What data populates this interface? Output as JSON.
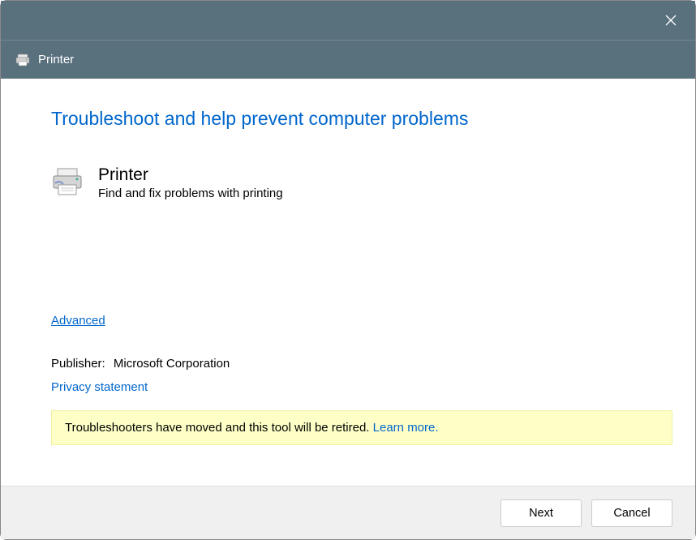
{
  "titlebar": {
    "window_name": "Printer"
  },
  "content": {
    "main_title": "Troubleshoot and help prevent computer problems",
    "troubleshooter": {
      "name": "Printer",
      "description": "Find and fix problems with printing"
    },
    "advanced_link": "Advanced",
    "publisher_label": "Publisher:",
    "publisher_value": "Microsoft Corporation",
    "privacy_link": "Privacy statement",
    "notice": {
      "text": "Troubleshooters have moved and this tool will be retired. ",
      "learn_more": "Learn more."
    }
  },
  "footer": {
    "next_label": "Next",
    "cancel_label": "Cancel"
  }
}
